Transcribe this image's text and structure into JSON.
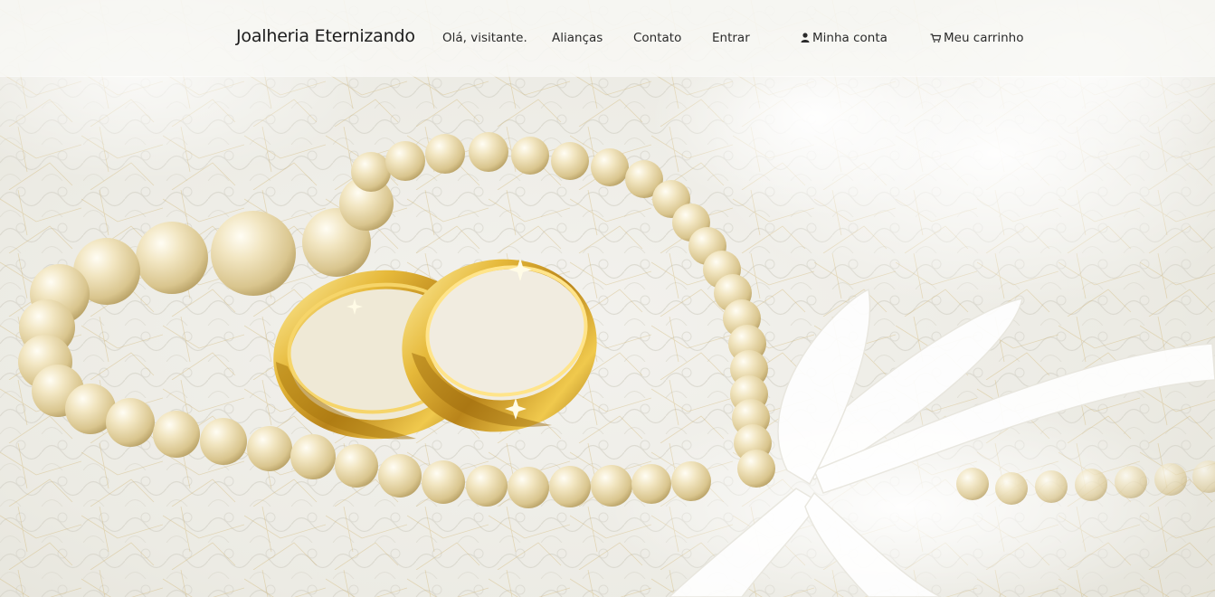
{
  "brand": {
    "name": "Joalheria Eternizando"
  },
  "nav": {
    "greeting": "Olá, visitante.",
    "links": {
      "aliancas": "Alianças",
      "contato": "Contato",
      "entrar": "Entrar",
      "minha_conta": "Minha conta",
      "meu_carrinho": "Meu carrinho"
    },
    "icons": {
      "account": "user-icon",
      "cart": "cart-icon"
    }
  },
  "hero": {
    "image": "wedding-rings-pearls-photo",
    "colors": {
      "gold": "#d4a62a",
      "pearl": "#efe4c2",
      "lace": "#f1efe8"
    }
  }
}
